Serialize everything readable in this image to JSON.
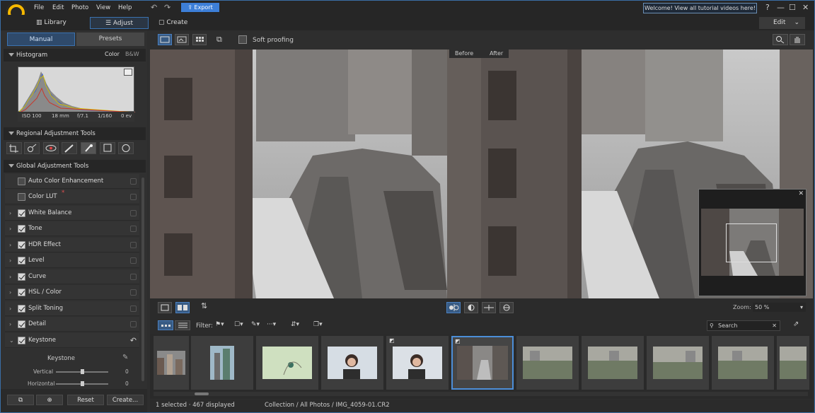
{
  "menu": [
    "File",
    "Edit",
    "Photo",
    "View",
    "Help"
  ],
  "export_label": "Export",
  "welcome": "Welcome! View all tutorial videos here!",
  "window": {
    "help": "?",
    "minimize": "—",
    "maximize": "☐",
    "close": "✕"
  },
  "modes": {
    "library": "Library",
    "adjust": "Adjust",
    "create": "Create"
  },
  "edit_label": "Edit",
  "tabs": {
    "manual": "Manual",
    "presets": "Presets"
  },
  "histogram": {
    "title": "Histogram",
    "color": "Color",
    "bw": "B&W",
    "iso": "ISO 100",
    "focal": "18 mm",
    "aperture": "f/7.1",
    "shutter": "1/160",
    "ev": "0 ev"
  },
  "regional": {
    "title": "Regional Adjustment Tools"
  },
  "global": {
    "title": "Global Adjustment Tools",
    "items": [
      {
        "label": "Auto Color Enhancement",
        "expandable": false,
        "checked": false
      },
      {
        "label": "Color LUT",
        "expandable": false,
        "checked": false,
        "badge": "*"
      },
      {
        "label": "White Balance",
        "expandable": true,
        "checked": true
      },
      {
        "label": "Tone",
        "expandable": true,
        "checked": true
      },
      {
        "label": "HDR Effect",
        "expandable": true,
        "checked": true
      },
      {
        "label": "Level",
        "expandable": true,
        "checked": true
      },
      {
        "label": "Curve",
        "expandable": true,
        "checked": true
      },
      {
        "label": "HSL / Color",
        "expandable": true,
        "checked": true
      },
      {
        "label": "Split Toning",
        "expandable": true,
        "checked": true
      },
      {
        "label": "Detail",
        "expandable": true,
        "checked": true
      },
      {
        "label": "Keystone",
        "expandable": true,
        "checked": true,
        "expanded": true
      }
    ]
  },
  "keystone": {
    "title": "Keystone",
    "vertical_label": "Vertical",
    "vertical_value": "0",
    "horizontal_label": "Horizontal",
    "horizontal_value": "0"
  },
  "bottom_buttons": {
    "reset": "Reset",
    "create": "Create..."
  },
  "toolbar": {
    "soft_proofing": "Soft proofing"
  },
  "compare": {
    "before": "Before",
    "after": "After"
  },
  "zoom": {
    "label": "Zoom:",
    "value": "50 %"
  },
  "filter": {
    "label": "Filter:"
  },
  "search_placeholder": "Search",
  "status": {
    "selection": "1 selected · 467 displayed",
    "path": "Collection / All Photos / IMG_4059-01.CR2"
  },
  "colors": {
    "accent": "#3d7fd8",
    "selection": "#4c8ed8",
    "logo": "#f5b800"
  }
}
